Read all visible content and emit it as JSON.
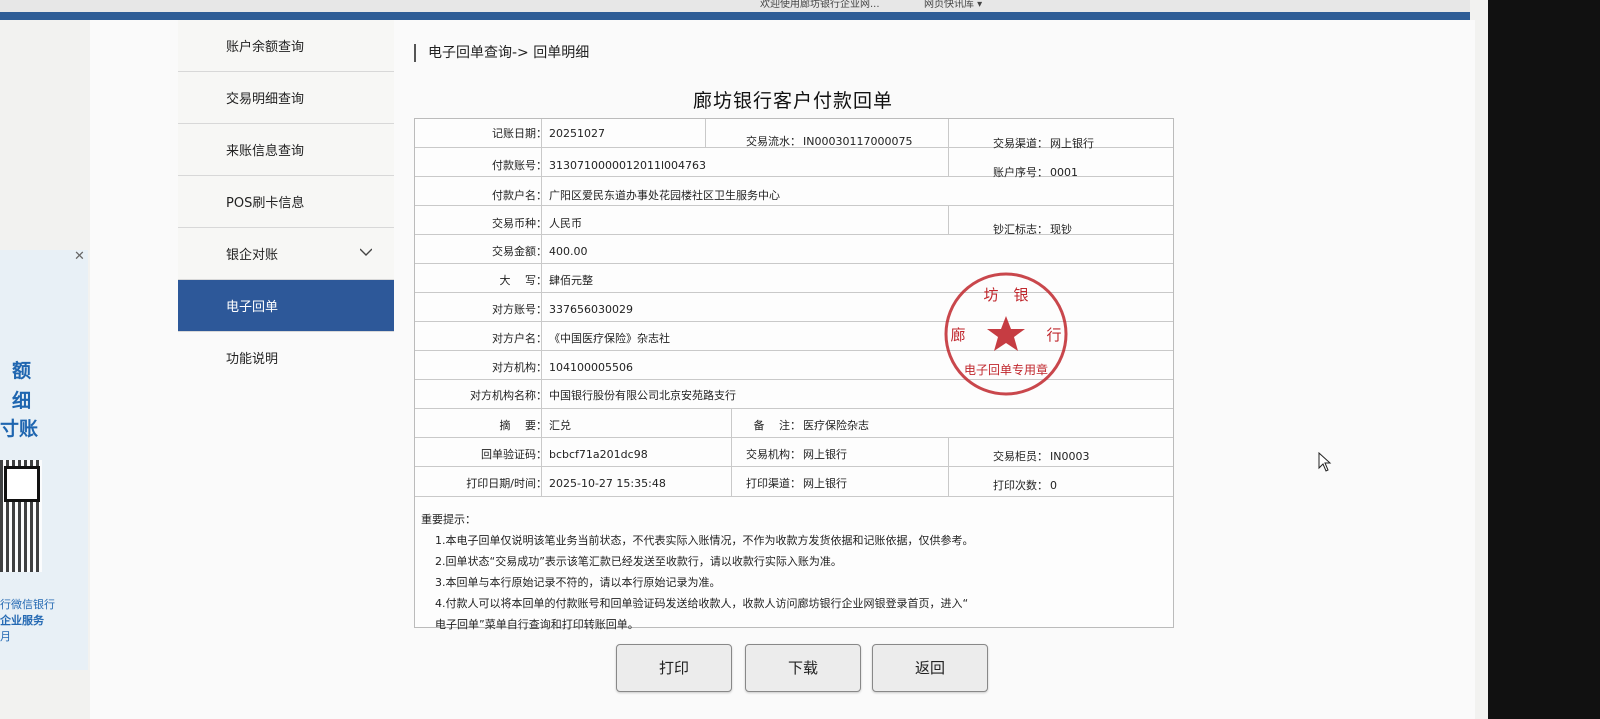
{
  "browser": {
    "tabs": [
      "欢迎使用廊坊银行企业网...",
      "网页快讯库 ▾"
    ]
  },
  "left_ad": {
    "big_lines": [
      "额",
      "细",
      "寸账"
    ],
    "small_lines": [
      "行微信银行",
      "企业服务",
      "月"
    ]
  },
  "sidebar": {
    "items": [
      {
        "label": "账户余额查询"
      },
      {
        "label": "交易明细查询"
      },
      {
        "label": "来账信息查询"
      },
      {
        "label": "POS刷卡信息"
      },
      {
        "label": "银企对账",
        "icon": "chevron-down-icon"
      },
      {
        "label": "电子回单",
        "active": true
      },
      {
        "label": "功能说明"
      }
    ]
  },
  "breadcrumb": "电子回单查询-> 回单明细",
  "receipt": {
    "title": "廊坊银行客户付款回单",
    "fields": {
      "posting_date": {
        "label": "记账日期：",
        "value": "20251027"
      },
      "txn_serial": {
        "label": "交易流水：",
        "value": "IN00030117000075"
      },
      "txn_channel": {
        "label": "交易渠道：",
        "value": "网上银行"
      },
      "payer_account": {
        "label": "付款账号：",
        "value": "3130710000012011l004763"
      },
      "account_seq": {
        "label": "账户序号：",
        "value": "0001"
      },
      "payer_name": {
        "label": "付款户名：",
        "value": "广阳区爱民东道办事处花园楼社区卫生服务中心"
      },
      "currency": {
        "label": "交易币种：",
        "value": "人民币"
      },
      "cash_flag": {
        "label": "钞汇标志：",
        "value": "现钞"
      },
      "amount": {
        "label": "交易金额：",
        "value": "400.00"
      },
      "amount_upper": {
        "label": "大　 写：",
        "value": "肆佰元整"
      },
      "counter_account": {
        "label": "对方账号：",
        "value": "337656030029"
      },
      "counter_name": {
        "label": "对方户名：",
        "value": "《中国医疗保险》杂志社"
      },
      "counter_org": {
        "label": "对方机构：",
        "value": "104100005506"
      },
      "counter_org_name": {
        "label": "对方机构名称：",
        "value": "中国银行股份有限公司北京安苑路支行"
      },
      "summary": {
        "label": "摘　 要：",
        "value": "汇兑"
      },
      "remark": {
        "label": "备　 注：",
        "value": "医疗保险杂志"
      },
      "verify_code": {
        "label": "回单验证码：",
        "value": "bcbcf71a201dc98"
      },
      "txn_org": {
        "label": "交易机构：",
        "value": "网上银行"
      },
      "teller": {
        "label": "交易柜员：",
        "value": "IN0003"
      },
      "print_time": {
        "label": "打印日期/时间：",
        "value": "2025-10-27 15:35:48"
      },
      "print_channel": {
        "label": "打印渠道：",
        "value": "网上银行"
      },
      "print_count": {
        "label": "打印次数：",
        "value": "0"
      }
    },
    "notes_title": "重要提示：",
    "notes": [
      "1.本电子回单仅说明该笔业务当前状态，不代表实际入账情况，不作为收款方发货依据和记账依据，仅供参考。",
      "2.回单状态“交易成功”表示该笔汇款已经发送至收款行，请以收款行实际入账为准。",
      "3.本回单与本行原始记录不符的，请以本行原始记录为准。",
      "4.付款人可以将本回单的付款账号和回单验证码发送给收款人，收款人访问廊坊银行企业网银登录首页，进入“",
      "  电子回单”菜单自行查询和打印转账回单。"
    ],
    "stamp": {
      "top_text": "坊　银",
      "left_char": "廊",
      "right_char": "行",
      "bottom_text": "电子回单专用章",
      "color": "#c0272d"
    }
  },
  "buttons": {
    "print": "打印",
    "download": "下载",
    "back": "返回"
  },
  "colors": {
    "accent": "#2d5899",
    "stamp": "#c0272d"
  }
}
